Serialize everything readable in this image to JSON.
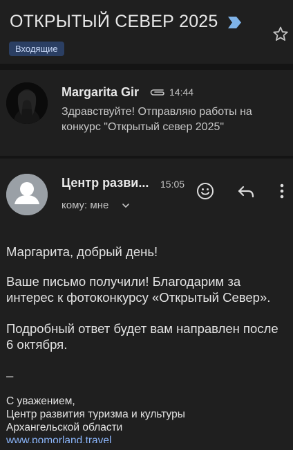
{
  "thread": {
    "subject": "ОТКРЫТЫЙ СЕВЕР 2025",
    "label": "Входящие"
  },
  "messages": [
    {
      "sender": "Margarita Gir",
      "time": "14:44",
      "snippet": "Здравствуйте! Отправляю работы на конкурс \"Открытый север 2025\""
    },
    {
      "sender": "Центр разви...",
      "time": "15:05",
      "recipient": "кому: мне",
      "greeting": "Маргарита, добрый день!",
      "paragraph1": "Ваше письмо получили! Благодарим за интерес к фотоконкурсу «Открытый Север».",
      "paragraph2": "Подробный ответ будет вам направлен после 6 октября.",
      "signature_dash": "–",
      "signature_line1": "С уважением,",
      "signature_line2": "Центр развития туризма и культуры",
      "signature_line3": "Архангельской области",
      "signature_link": "www.pomorland.travel"
    }
  ],
  "colors": {
    "background": "#1f1f1f",
    "separator": "#141414",
    "label_chip": "#2b3f63",
    "link": "#8ab4f8",
    "important_marker": "#7fb3e8"
  },
  "icons": [
    "important-marker-icon",
    "star-icon",
    "attachment-icon",
    "emoji-reaction-icon",
    "reply-icon",
    "more-options-icon",
    "chevron-down-icon",
    "person-avatar-icon"
  ]
}
